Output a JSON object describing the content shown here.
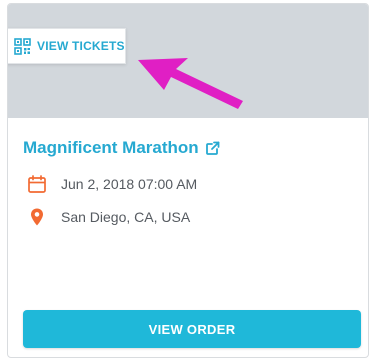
{
  "card": {
    "tickets_button_label": "VIEW TICKETS",
    "event_title": "Magnificent Marathon",
    "date_time": "Jun 2, 2018 07:00 AM",
    "location": "San Diego, CA, USA",
    "order_button_label": "VIEW ORDER"
  },
  "icons": {
    "tickets": "qr-code-icon",
    "title_link": "external-link-icon",
    "date": "calendar-icon",
    "location": "map-pin-icon"
  },
  "colors": {
    "accent": "#26a9d1",
    "button": "#1fb8d9",
    "icon_orange": "#f26a32",
    "annotation_arrow": "#e01fc4",
    "banner": "#d2d7dc"
  }
}
